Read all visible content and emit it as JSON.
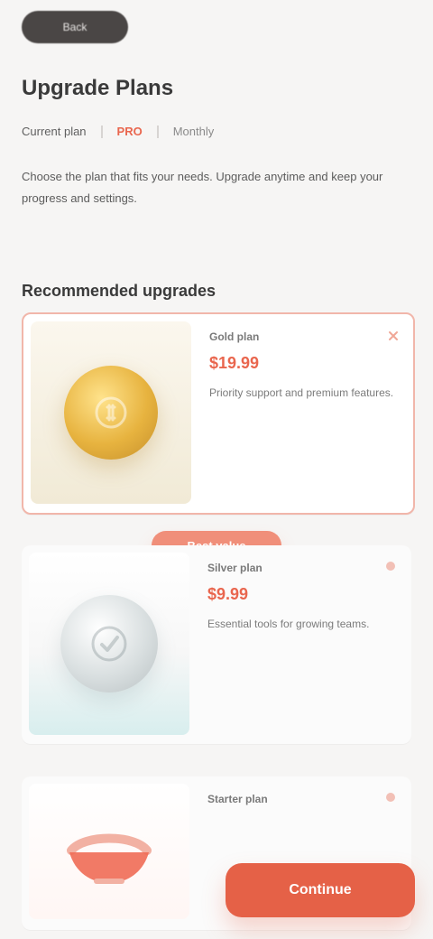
{
  "top_pill": {
    "label": "Back"
  },
  "header": {
    "title": "Upgrade Plans",
    "meta": {
      "left": "Current plan",
      "badge": "PRO",
      "right": "Monthly"
    },
    "description": "Choose the plan that fits your needs. Upgrade anytime and keep your progress and settings."
  },
  "section": {
    "title": "Recommended upgrades"
  },
  "cards": [
    {
      "kicker": "Gold plan",
      "price": "$19.99",
      "blurb": "Priority support and premium features."
    },
    {
      "kicker": "Silver plan",
      "price": "$9.99",
      "blurb": "Essential tools for growing teams."
    },
    {
      "kicker": "Starter plan",
      "price": "",
      "blurb": ""
    }
  ],
  "mid_pill": {
    "label": "Best value"
  },
  "cta": {
    "label": "Continue"
  },
  "icons": {
    "close": "close-icon",
    "more": "more-icon",
    "coin": "coin-icon",
    "badge": "badge-icon",
    "bowl": "bowl-icon"
  },
  "colors": {
    "accent": "#e56147",
    "accent_soft": "#f08f7a",
    "highlight_border": "#f1b6aa"
  }
}
